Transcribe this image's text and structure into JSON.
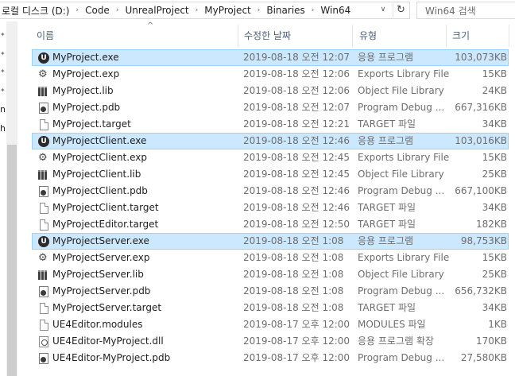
{
  "address": {
    "crumbs": [
      "로컬 디스크 (D:)",
      "Code",
      "UnrealProject",
      "MyProject",
      "Binaries",
      "Win64"
    ],
    "separator": "›",
    "dropdown_glyph": "∨",
    "refresh_glyph": "↻"
  },
  "search": {
    "placeholder": "Win64 검색"
  },
  "nav": {
    "fragments": [
      "n",
      "hr"
    ]
  },
  "columns": {
    "name": "이름",
    "date": "수정한 날짜",
    "type": "유형",
    "size": "크기",
    "sort_glyph": "^"
  },
  "files": [
    {
      "icon": "unreal-exe-icon",
      "name": "MyProject.exe",
      "date": "2019-08-18 오전 12:07",
      "type": "응용 프로그램",
      "size": "103,073KB",
      "selected": true
    },
    {
      "icon": "gears-icon",
      "name": "MyProject.exp",
      "date": "2019-08-18 오전 12:06",
      "type": "Exports Library File",
      "size": "15KB",
      "selected": false
    },
    {
      "icon": "library-icon",
      "name": "MyProject.lib",
      "date": "2019-08-18 오전 12:06",
      "type": "Object File Library",
      "size": "24KB",
      "selected": false
    },
    {
      "icon": "pdb-icon",
      "name": "MyProject.pdb",
      "date": "2019-08-18 오전 12:07",
      "type": "Program Debug ...",
      "size": "667,316KB",
      "selected": false
    },
    {
      "icon": "file-icon",
      "name": "MyProject.target",
      "date": "2019-08-18 오전 12:21",
      "type": "TARGET 파일",
      "size": "34KB",
      "selected": false
    },
    {
      "icon": "unreal-exe-icon",
      "name": "MyProjectClient.exe",
      "date": "2019-08-18 오전 12:46",
      "type": "응용 프로그램",
      "size": "103,016KB",
      "selected": true
    },
    {
      "icon": "gears-icon",
      "name": "MyProjectClient.exp",
      "date": "2019-08-18 오전 12:45",
      "type": "Exports Library File",
      "size": "15KB",
      "selected": false
    },
    {
      "icon": "library-icon",
      "name": "MyProjectClient.lib",
      "date": "2019-08-18 오전 12:45",
      "type": "Object File Library",
      "size": "25KB",
      "selected": false
    },
    {
      "icon": "pdb-icon",
      "name": "MyProjectClient.pdb",
      "date": "2019-08-18 오전 12:46",
      "type": "Program Debug ...",
      "size": "667,100KB",
      "selected": false
    },
    {
      "icon": "file-icon",
      "name": "MyProjectClient.target",
      "date": "2019-08-18 오전 12:46",
      "type": "TARGET 파일",
      "size": "34KB",
      "selected": false
    },
    {
      "icon": "file-icon",
      "name": "MyProjectEditor.target",
      "date": "2019-08-18 오전 12:50",
      "type": "TARGET 파일",
      "size": "182KB",
      "selected": false
    },
    {
      "icon": "unreal-exe-icon",
      "name": "MyProjectServer.exe",
      "date": "2019-08-18 오전 1:08",
      "type": "응용 프로그램",
      "size": "98,753KB",
      "selected": true
    },
    {
      "icon": "gears-icon",
      "name": "MyProjectServer.exp",
      "date": "2019-08-18 오전 1:08",
      "type": "Exports Library File",
      "size": "15KB",
      "selected": false
    },
    {
      "icon": "library-icon",
      "name": "MyProjectServer.lib",
      "date": "2019-08-18 오전 1:08",
      "type": "Object File Library",
      "size": "25KB",
      "selected": false
    },
    {
      "icon": "pdb-icon",
      "name": "MyProjectServer.pdb",
      "date": "2019-08-18 오전 1:08",
      "type": "Program Debug ...",
      "size": "656,732KB",
      "selected": false
    },
    {
      "icon": "file-icon",
      "name": "MyProjectServer.target",
      "date": "2019-08-18 오전 1:08",
      "type": "TARGET 파일",
      "size": "34KB",
      "selected": false
    },
    {
      "icon": "file-icon",
      "name": "UE4Editor.modules",
      "date": "2019-08-17 오후 12:00",
      "type": "MODULES 파일",
      "size": "1KB",
      "selected": false
    },
    {
      "icon": "dll-icon",
      "name": "UE4Editor-MyProject.dll",
      "date": "2019-08-17 오후 12:00",
      "type": "응용 프로그램 확장",
      "size": "170KB",
      "selected": false
    },
    {
      "icon": "pdb-icon",
      "name": "UE4Editor-MyProject.pdb",
      "date": "2019-08-17 오후 12:00",
      "type": "Program Debug ...",
      "size": "27,580KB",
      "selected": false
    }
  ],
  "colors": {
    "selection_bg": "#cce8ff",
    "selection_border": "#99d1ff",
    "header_text": "#4c607a"
  }
}
